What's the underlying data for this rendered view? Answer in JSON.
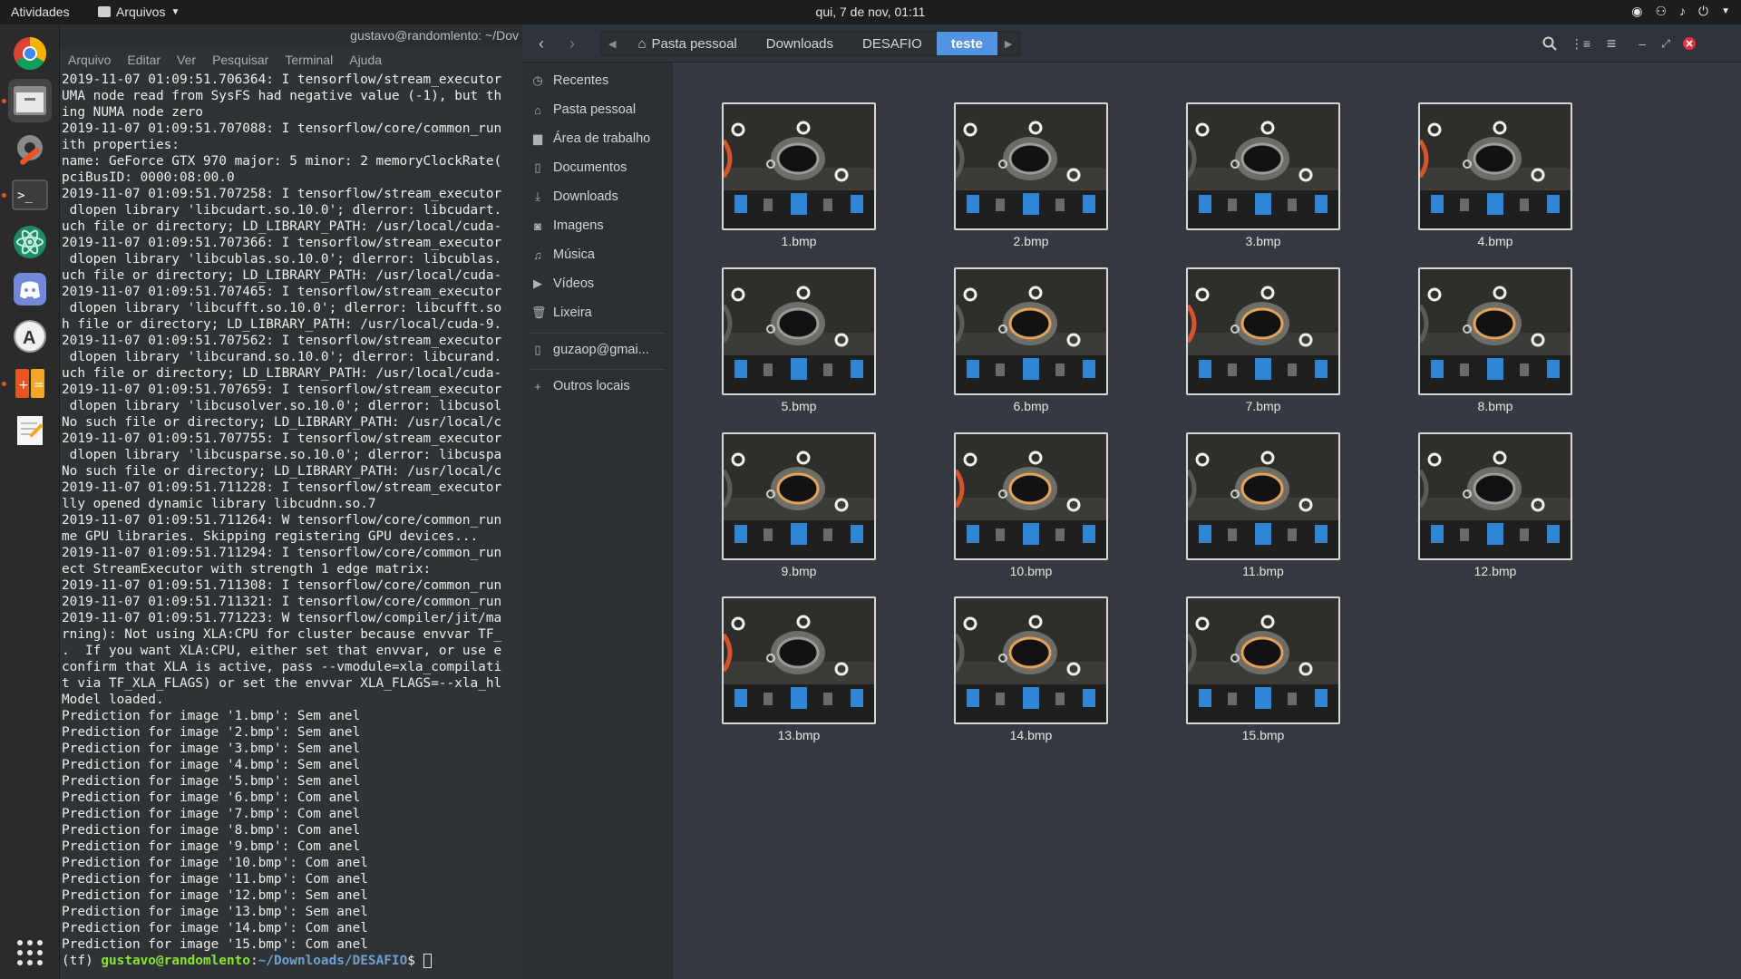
{
  "topbar": {
    "activities": "Atividades",
    "app_menu": "Arquivos",
    "clock": "qui, 7 de nov, 01:11"
  },
  "dock": {
    "items": [
      "chrome-icon",
      "files-icon",
      "settings-icon",
      "terminal-icon",
      "atom-icon",
      "discord-icon",
      "software-icon",
      "calculator-icon",
      "text-editor-icon",
      "app-grid-icon"
    ]
  },
  "terminal": {
    "title": "gustavo@randomlento: ~/Dov",
    "menu": [
      "Arquivo",
      "Editar",
      "Ver",
      "Pesquisar",
      "Terminal",
      "Ajuda"
    ],
    "lines": [
      "2019-11-07 01:09:51.706364: I tensorflow/stream_executor",
      "UMA node read from SysFS had negative value (-1), but th",
      "ing NUMA node zero",
      "2019-11-07 01:09:51.707088: I tensorflow/core/common_run",
      "ith properties:",
      "name: GeForce GTX 970 major: 5 minor: 2 memoryClockRate(",
      "pciBusID: 0000:08:00.0",
      "2019-11-07 01:09:51.707258: I tensorflow/stream_executor",
      " dlopen library 'libcudart.so.10.0'; dlerror: libcudart.",
      "uch file or directory; LD_LIBRARY_PATH: /usr/local/cuda-",
      "2019-11-07 01:09:51.707366: I tensorflow/stream_executor",
      " dlopen library 'libcublas.so.10.0'; dlerror: libcublas.",
      "uch file or directory; LD_LIBRARY_PATH: /usr/local/cuda-",
      "2019-11-07 01:09:51.707465: I tensorflow/stream_executor",
      " dlopen library 'libcufft.so.10.0'; dlerror: libcufft.so",
      "h file or directory; LD_LIBRARY_PATH: /usr/local/cuda-9.",
      "2019-11-07 01:09:51.707562: I tensorflow/stream_executor",
      " dlopen library 'libcurand.so.10.0'; dlerror: libcurand.",
      "uch file or directory; LD_LIBRARY_PATH: /usr/local/cuda-",
      "2019-11-07 01:09:51.707659: I tensorflow/stream_executor",
      " dlopen library 'libcusolver.so.10.0'; dlerror: libcusol",
      "No such file or directory; LD_LIBRARY_PATH: /usr/local/c",
      "2019-11-07 01:09:51.707755: I tensorflow/stream_executor",
      " dlopen library 'libcusparse.so.10.0'; dlerror: libcuspa",
      "No such file or directory; LD_LIBRARY_PATH: /usr/local/c",
      "2019-11-07 01:09:51.711228: I tensorflow/stream_executor",
      "lly opened dynamic library libcudnn.so.7",
      "2019-11-07 01:09:51.711264: W tensorflow/core/common_run",
      "me GPU libraries. Skipping registering GPU devices...",
      "2019-11-07 01:09:51.711294: I tensorflow/core/common_run",
      "ect StreamExecutor with strength 1 edge matrix:",
      "2019-11-07 01:09:51.711308: I tensorflow/core/common_run",
      "2019-11-07 01:09:51.711321: I tensorflow/core/common_run",
      "2019-11-07 01:09:51.771223: W tensorflow/compiler/jit/ma",
      "rning): Not using XLA:CPU for cluster because envvar TF_",
      ".  If you want XLA:CPU, either set that envvar, or use e",
      "confirm that XLA is active, pass --vmodule=xla_compilati",
      "t via TF_XLA_FLAGS) or set the envvar XLA_FLAGS=--xla_hl",
      "Model loaded.",
      "Prediction for image '1.bmp': Sem anel",
      "Prediction for image '2.bmp': Sem anel",
      "Prediction for image '3.bmp': Sem anel",
      "Prediction for image '4.bmp': Sem anel",
      "Prediction for image '5.bmp': Sem anel",
      "Prediction for image '6.bmp': Com anel",
      "Prediction for image '7.bmp': Com anel",
      "Prediction for image '8.bmp': Com anel",
      "Prediction for image '9.bmp': Com anel",
      "Prediction for image '10.bmp': Com anel",
      "Prediction for image '11.bmp': Com anel",
      "Prediction for image '12.bmp': Sem anel",
      "Prediction for image '13.bmp': Sem anel",
      "Prediction for image '14.bmp': Com anel",
      "Prediction for image '15.bmp': Com anel"
    ],
    "prompt_env": "(tf) ",
    "prompt_user": "gustavo@randomlento",
    "prompt_sep": ":",
    "prompt_path": "~/Downloads/DESAFIO",
    "prompt_end": "$ "
  },
  "files": {
    "breadcrumbs": [
      "Pasta pessoal",
      "Downloads",
      "DESAFIO",
      "teste"
    ],
    "sidebar": [
      {
        "label": "Recentes",
        "icon": "clock-icon"
      },
      {
        "label": "Pasta pessoal",
        "icon": "home-icon"
      },
      {
        "label": "Área de trabalho",
        "icon": "folder-icon"
      },
      {
        "label": "Documentos",
        "icon": "document-icon"
      },
      {
        "label": "Downloads",
        "icon": "download-icon"
      },
      {
        "label": "Imagens",
        "icon": "camera-icon"
      },
      {
        "label": "Música",
        "icon": "music-icon"
      },
      {
        "label": "Vídeos",
        "icon": "video-icon"
      },
      {
        "label": "Lixeira",
        "icon": "trash-icon"
      },
      {
        "label": "guzaop@gmai...",
        "icon": "network-drive-icon"
      },
      {
        "label": "Outros locais",
        "icon": "plus-icon"
      }
    ],
    "items": [
      "1.bmp",
      "2.bmp",
      "3.bmp",
      "4.bmp",
      "5.bmp",
      "6.bmp",
      "7.bmp",
      "8.bmp",
      "9.bmp",
      "10.bmp",
      "11.bmp",
      "12.bmp",
      "13.bmp",
      "14.bmp",
      "15.bmp"
    ]
  }
}
